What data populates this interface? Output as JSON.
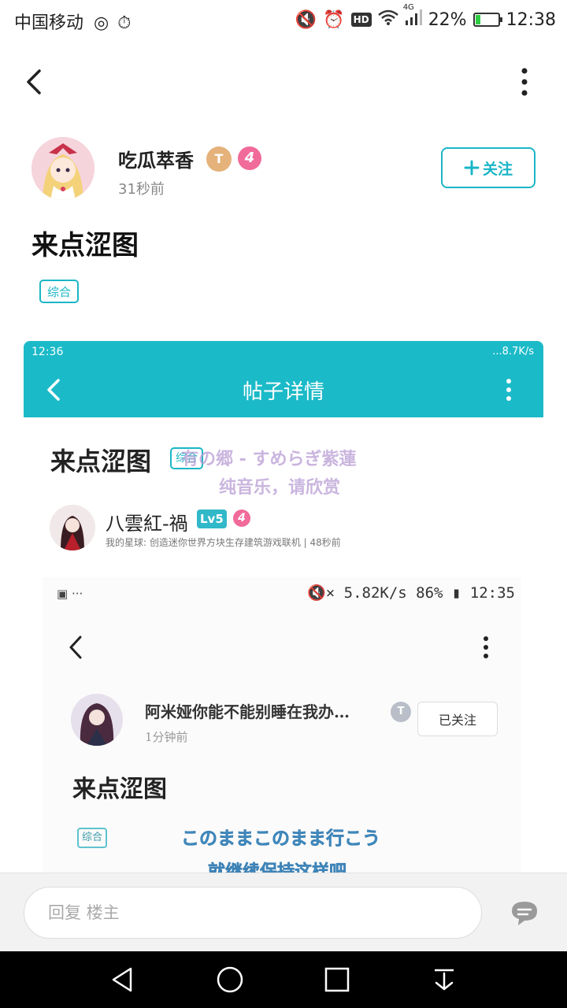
{
  "status_bar": {
    "carrier": "中国移动",
    "network": "4G",
    "battery_percent_text": "22%",
    "battery_level": 0.22,
    "time": "12:38",
    "hd_label": "HD",
    "icons": [
      "notification-icon",
      "timer-icon",
      "mute-icon",
      "alarm-icon",
      "hd-icon",
      "wifi-icon",
      "signal-icon",
      "battery-icon"
    ]
  },
  "author": {
    "name": "吃瓜萃香",
    "badge_t": "T",
    "badge_number": "4",
    "time_ago": "31秒前"
  },
  "follow_label": "关注",
  "post": {
    "title": "来点涩图",
    "tag": "综合"
  },
  "embedded": {
    "status_time": "12:36",
    "status_right": "...8.7K/s",
    "header_title": "帖子详情",
    "post_title": "来点涩图",
    "tag": "综合",
    "overlay_lyric_1": "有の郷 - すめらぎ紫蓮",
    "overlay_lyric_2": "纯音乐，请欣赏",
    "author_name": "八雲紅-禍",
    "author_level": "Lv5",
    "author_badge_number": "4",
    "meta": "我的星球: 创造迷你世界方块生存建筑游戏联机 | 48秒前",
    "inner": {
      "status_left": "▣ ···",
      "status_right": "🔇× 5.82K/s  86% ▮ 12:35",
      "author_name": "阿米娅你能不能别睡在我办…",
      "badge": "T",
      "follow_label": "已关注",
      "time_ago": "1分钟前",
      "post_title": "来点涩图",
      "tag": "综合"
    },
    "lyric_jp": "このままこのまま行こう",
    "lyric_cn": "就继续保持这样吧"
  },
  "reply": {
    "placeholder": "回复  楼主"
  },
  "colors": {
    "accent": "#1bb6c7",
    "embedded_header": "#1bbac8",
    "badge_pink": "#f06a9a",
    "badge_gold": "#e4b27a"
  }
}
